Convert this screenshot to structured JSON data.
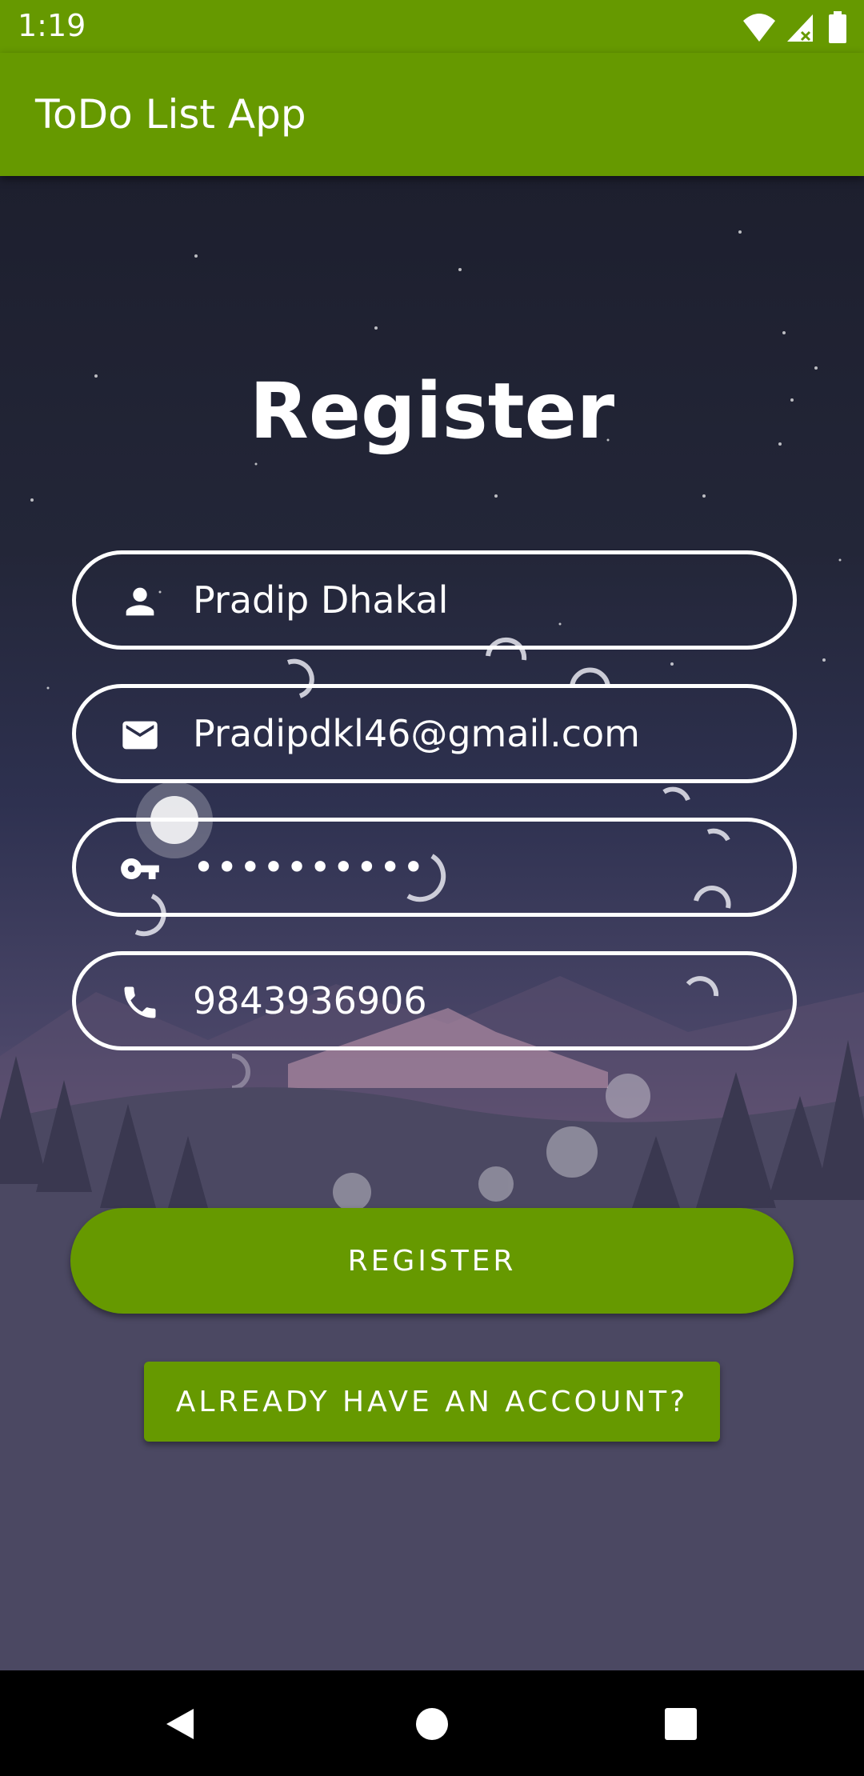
{
  "status_bar": {
    "time": "1:19",
    "icons": [
      "wifi-icon",
      "signal-icon",
      "battery-icon"
    ]
  },
  "app_bar": {
    "title": "ToDo List App",
    "color": "#669900"
  },
  "form": {
    "title": "Register",
    "fields": [
      {
        "icon": "person-icon",
        "value": "Pradip Dhakal",
        "type": "text"
      },
      {
        "icon": "email-icon",
        "value": "Pradipdkl46@gmail.com",
        "type": "email"
      },
      {
        "icon": "key-icon",
        "value": "••••••••••",
        "type": "password"
      },
      {
        "icon": "phone-icon",
        "value": "9843936906",
        "type": "tel"
      }
    ],
    "register_label": "REGISTER",
    "login_label": "ALREADY HAVE AN ACCOUNT?"
  },
  "nav_bar": {
    "buttons": [
      "back-icon",
      "home-icon",
      "recents-icon"
    ]
  }
}
